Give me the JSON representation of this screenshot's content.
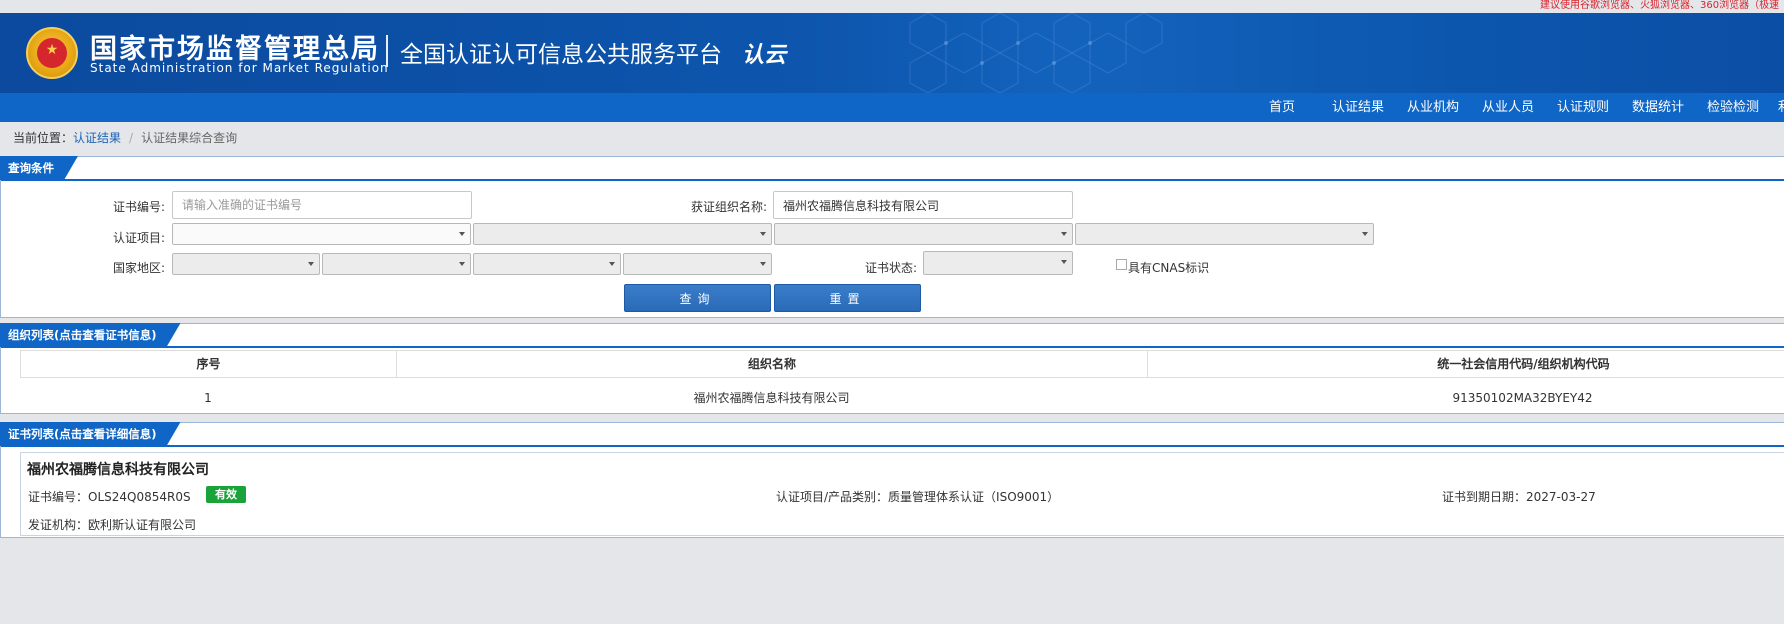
{
  "top_note": "建议使用谷歌浏览器、火狐浏览器、360浏览器（极速",
  "header": {
    "org_cn": "国家市场监督管理总局",
    "org_en": "State Administration  for  Market Regulation",
    "platform_title": "全国认证认可信息公共服务平台",
    "logo_text": "认云"
  },
  "nav": {
    "items": [
      "首页",
      "认证结果",
      "从业机构",
      "从业人员",
      "认证规则",
      "数据统计",
      "检验检测",
      "利"
    ]
  },
  "breadcrumb": {
    "prefix": "当前位置：",
    "link": "认证结果",
    "sep": "/",
    "current": "认证结果综合查询"
  },
  "query": {
    "title": "查询条件",
    "cert_no_label": "证书编号:",
    "cert_no_placeholder": "请输入准确的证书编号",
    "org_label": "获证组织名称:",
    "org_value": "福州农福腾信息科技有限公司",
    "project_label": "认证项目:",
    "region_label": "国家地区:",
    "status_label": "证书状态:",
    "cnas_label": "具有CNAS标识",
    "search_button": "查询",
    "reset_button": "重置"
  },
  "org_list": {
    "title": "组织列表(点击查看证书信息)",
    "headers": [
      "序号",
      "组织名称",
      "统一社会信用代码/组织机构代码"
    ],
    "rows": [
      {
        "no": "1",
        "name": "福州农福腾信息科技有限公司",
        "code": "91350102MA32BYEY42"
      }
    ]
  },
  "cert_list": {
    "title": "证书列表(点击查看详细信息)",
    "items": [
      {
        "org": "福州农福腾信息科技有限公司",
        "cert_no": "证书编号：OLS24Q0854R0S",
        "status": "有效",
        "project": "认证项目/产品类别：质量管理体系认证（ISO9001）",
        "expiry": "证书到期日期：2027-03-27",
        "issuer": "发证机构：欧利斯认证有限公司"
      }
    ]
  },
  "colors": {
    "header_blue": "#0d55ad",
    "nav_blue": "#0f66c7",
    "link_blue": "#1a64b8",
    "valid_green": "#1aa33a",
    "top_note_red": "#d8242b"
  }
}
